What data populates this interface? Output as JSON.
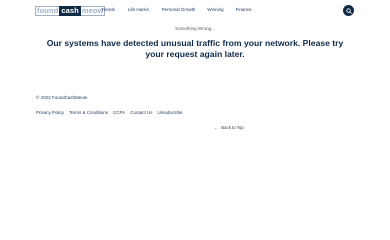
{
  "header": {
    "logo": {
      "part1": "found",
      "part2": "cash",
      "part3": "meow"
    },
    "nav": [
      "Trends",
      "Life Hacks",
      "Personal Growth",
      "Winning",
      "Finance"
    ],
    "search_icon": "search-icon"
  },
  "main": {
    "status": "Something Wrong...",
    "headline": "Our systems have detected unusual traffic from your network. Please try your request again later."
  },
  "footer": {
    "copyright": "© 2023 FoundCashMeow",
    "links": [
      "Privacy Policy",
      "Terms & Conditions",
      "CCPA",
      "Contact Us",
      "Unsubscribe"
    ],
    "back_to_top": "Back to Top",
    "back_arrow": "←"
  },
  "colors": {
    "brand": "#0e2a47",
    "accent": "#9fb2c6"
  }
}
